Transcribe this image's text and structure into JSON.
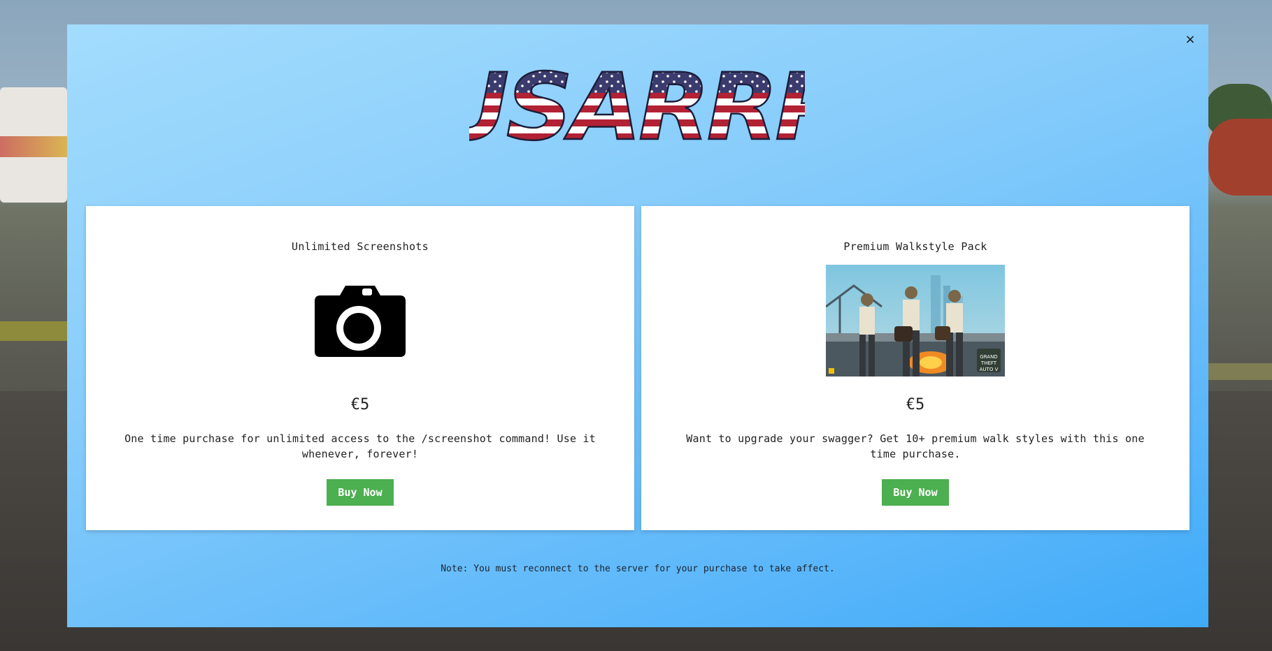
{
  "modal": {
    "close_label": "×",
    "logo_text": "USARRP",
    "note": "Note: You must reconnect to the server for your purchase to take affect."
  },
  "products": [
    {
      "title": "Unlimited Screenshots",
      "icon": "camera-icon",
      "price": "€5",
      "description": "One time purchase for unlimited access to the /screenshot command! Use it whenever, forever!",
      "button_label": "Buy Now"
    },
    {
      "title": "Premium Walkstyle Pack",
      "icon": "gta-v-artwork",
      "price": "€5",
      "description": "Want to upgrade your swagger? Get 10+ premium walk styles with this one time purchase.",
      "button_label": "Buy Now"
    }
  ],
  "colors": {
    "buy_button": "#4caf50",
    "modal_light": "#a3dcfd",
    "modal_dark": "#3faaf8",
    "flag_red": "#b22234",
    "flag_blue": "#3c3b6e"
  }
}
